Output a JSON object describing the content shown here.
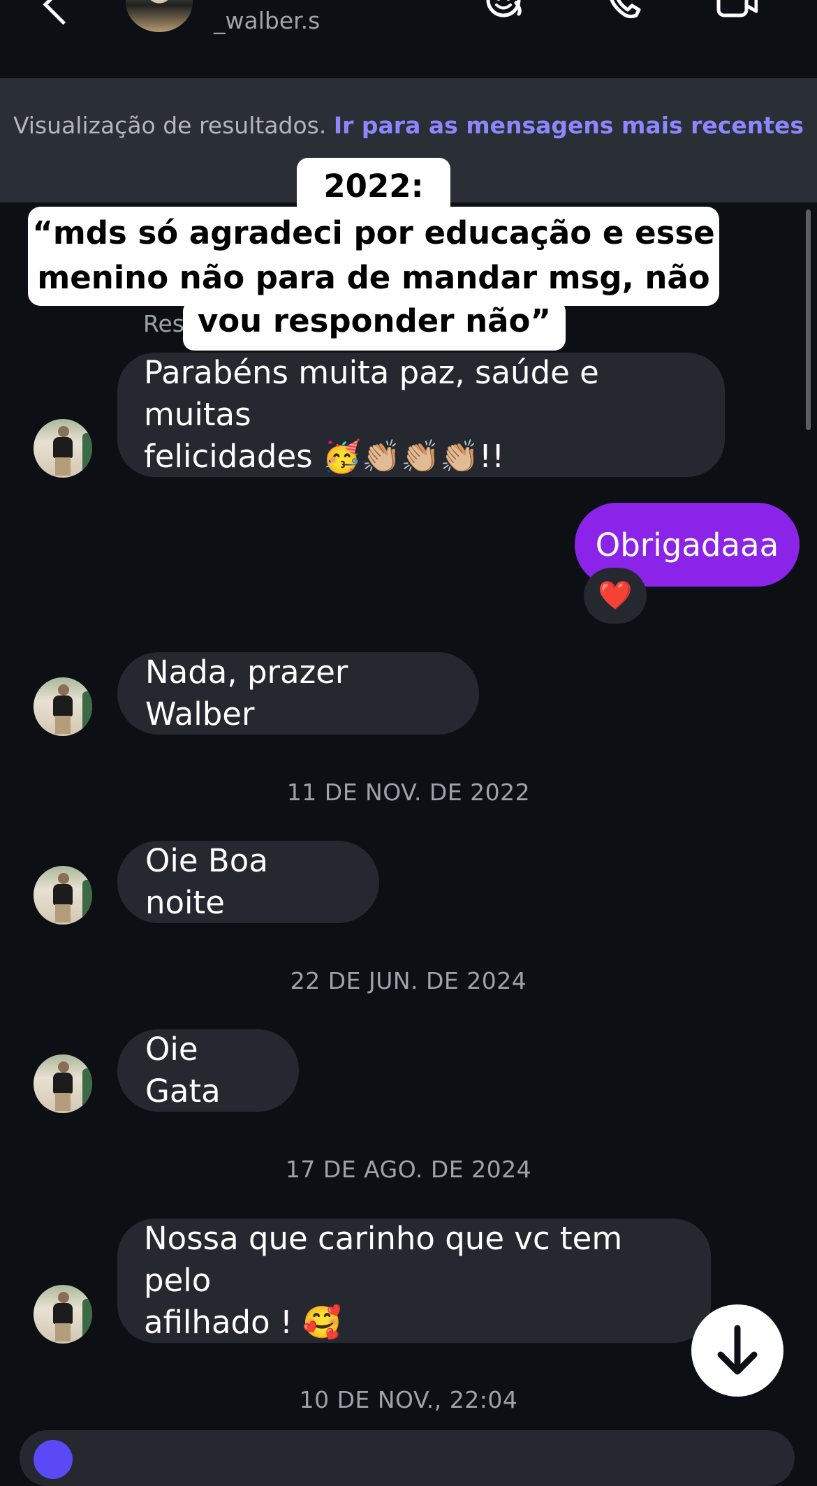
{
  "header": {
    "username": "_walber.s",
    "icons": [
      "back-chevron-icon",
      "avatar",
      "sticker-icon",
      "phone-icon",
      "video-camera-icon"
    ]
  },
  "banner": {
    "text": "Visualização de resultados.",
    "link": "Ir para as mensagens mais recentes"
  },
  "caption": {
    "year": "2022:",
    "line1": "“mds só agradeci por educação e esse",
    "line2": "menino não para de mandar msg, não",
    "line3": "vou responder não”"
  },
  "peek_text": "Res",
  "messages": {
    "m1_line1": "Parabéns muita paz, saúde e muitas",
    "m1_line2": "felicidades 🥳👏🏼👏🏼👏🏼!!",
    "m2": "Obrigadaaa",
    "m2_reaction": "❤️",
    "m3": "Nada, prazer Walber",
    "m4": "Oie  Boa noite",
    "m5": "Oie Gata",
    "m6_line1": "Nossa que carinho que vc tem pelo",
    "m6_line2": "afilhado ! 🥰"
  },
  "dates": {
    "d1": "11 DE NOV. DE 2022",
    "d2": "22 DE JUN. DE 2024",
    "d3": "17 DE AGO. DE 2024",
    "d4": "10 DE NOV., 22:04"
  },
  "colors": {
    "background": "#0c1015",
    "bubble_incoming": "#25282e",
    "bubble_outgoing": "#8b24e8",
    "link": "#8e86ff"
  }
}
